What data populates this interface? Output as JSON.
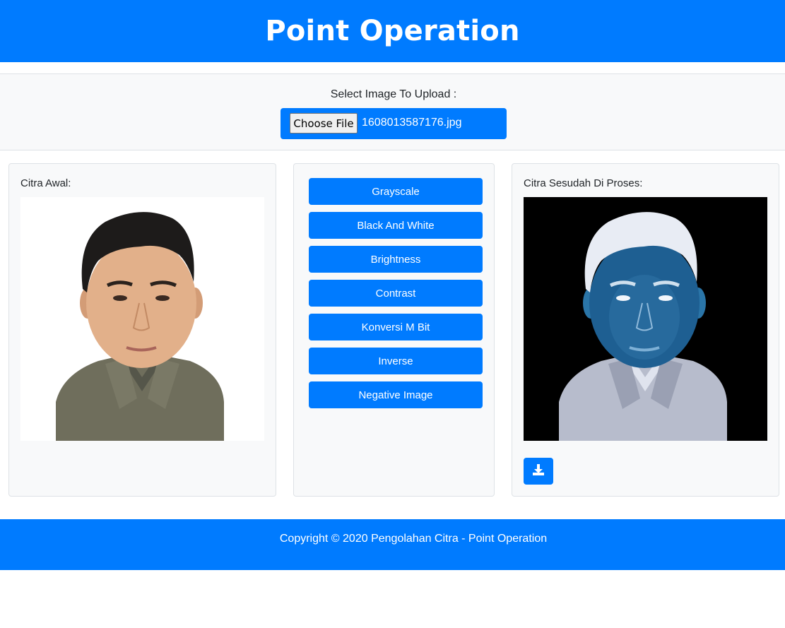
{
  "header": {
    "title": "Point Operation"
  },
  "upload": {
    "label": "Select Image To Upload :",
    "choose_button": "Choose File",
    "file_name": "1608013587176.jpg"
  },
  "original": {
    "label": "Citra Awal:"
  },
  "operations": [
    "Grayscale",
    "Black And White",
    "Brightness",
    "Contrast",
    "Konversi M Bit",
    "Inverse",
    "Negative Image"
  ],
  "processed": {
    "label": "Citra Sesudah Di Proses:",
    "download_icon": "download-icon"
  },
  "footer": {
    "text": "Copyright © 2020 Pengolahan Citra - Point Operation"
  },
  "colors": {
    "primary": "#007bff",
    "panel": "#f8f9fa",
    "border": "#dee2e6"
  }
}
